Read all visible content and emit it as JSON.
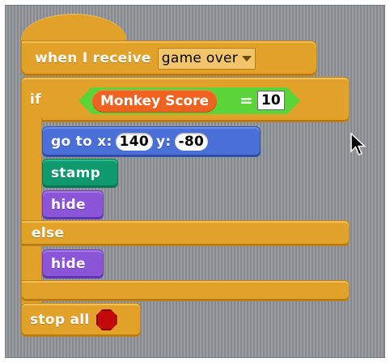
{
  "script": {
    "hat": {
      "label": "when I receive",
      "message": "game over"
    },
    "if_block": {
      "label": "if",
      "condition": {
        "variable": "Monkey Score",
        "operator": "=",
        "value": "10"
      }
    },
    "then_blocks": {
      "goto": {
        "label_x": "go to x:",
        "x_value": "140",
        "label_y": "y:",
        "y_value": "-80"
      },
      "stamp": {
        "label": "stamp"
      },
      "hide": {
        "label": "hide"
      }
    },
    "else_label": "else",
    "else_blocks": {
      "hide": {
        "label": "hide"
      }
    },
    "stop": {
      "label": "stop all"
    }
  },
  "colors": {
    "control": "#e2a22a",
    "motion": "#4a6fd6",
    "pen": "#0e9a6c",
    "looks": "#8a55d7",
    "operator": "#5bd43a",
    "variable": "#f0621f",
    "stop_sign": "#c50808"
  },
  "icons": {
    "dropdown": "chevron-down-icon",
    "stop": "stop-sign-icon",
    "cursor": "mouse-pointer-icon"
  }
}
